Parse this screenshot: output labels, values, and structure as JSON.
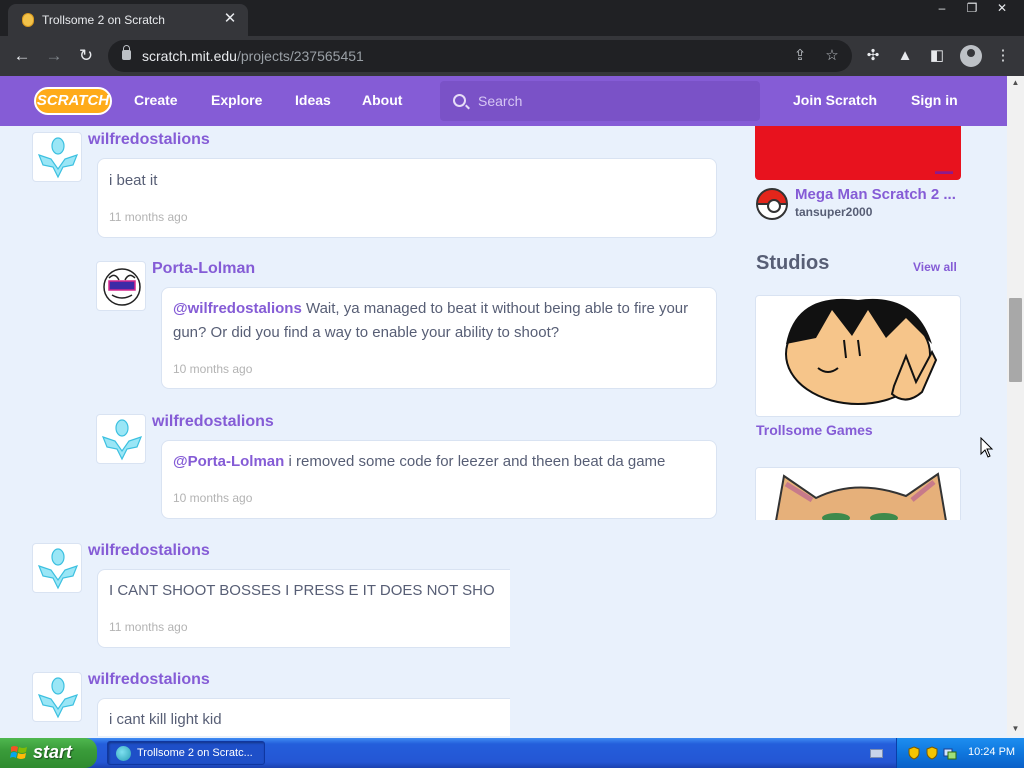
{
  "browser": {
    "tab_title": "Trollsome 2 on Scratch",
    "tab_close": "✕",
    "url_host": "scratch.mit.edu",
    "url_path": "/projects/237565451",
    "window_controls": [
      "–",
      "❐",
      "✕"
    ]
  },
  "navbar": {
    "logo": "SCRATCH",
    "links": [
      "Create",
      "Explore",
      "Ideas",
      "About"
    ],
    "search_placeholder": "Search",
    "join": "Join Scratch",
    "sign_in": "Sign in",
    "brand_color": "#855cd6"
  },
  "comments": [
    {
      "user": "wilfredostalions",
      "text": "i beat it",
      "time": "11 months ago"
    },
    {
      "user": "Porta-Lolman",
      "mention": "@wilfredostalions",
      "text": " Wait, ya managed to beat it without being able to fire your gun? Or did you find a way to enable your ability to shoot?",
      "time": "10 months ago"
    },
    {
      "user": "wilfredostalions",
      "mention": "@Porta-Lolman",
      "text": " i removed some code for leezer and theen beat da game",
      "time": "10 months ago"
    },
    {
      "user": "wilfredostalions",
      "text": "I CANT SHOOT BOSSES I PRESS E IT DOES NOT SHO",
      "time": "11 months ago"
    },
    {
      "user": "wilfredostalions",
      "text": "i cant kill light kid",
      "time": ""
    }
  ],
  "sidebar": {
    "project": {
      "title": "Mega Man Scratch 2 ...",
      "author": "tansuper2000"
    },
    "studios_heading": "Studios",
    "view_all": "View all",
    "studios": [
      {
        "title": "Trollsome Games"
      }
    ]
  },
  "taskbar": {
    "start": "start",
    "task_label": "Trollsome 2 on Scratc...",
    "clock": "10:24 PM"
  }
}
